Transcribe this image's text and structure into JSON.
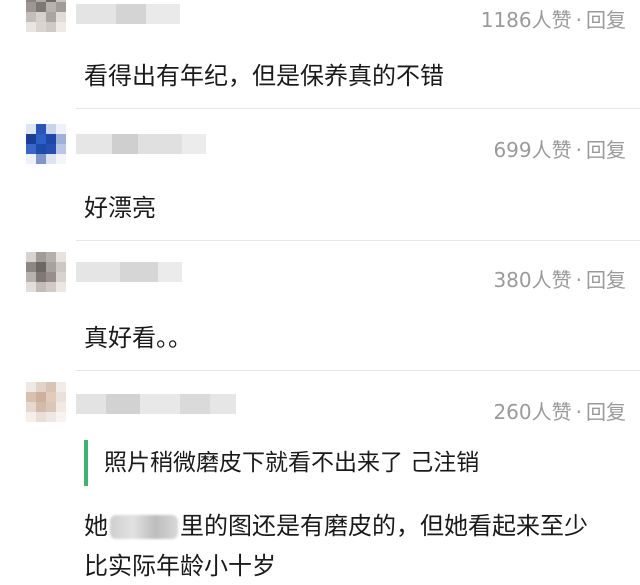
{
  "comments": [
    {
      "likes_text": "1186人赞",
      "dot": "·",
      "reply": "回复",
      "text": "看得出有年纪，但是保养真的不错"
    },
    {
      "likes_text": "699人赞",
      "dot": "·",
      "reply": "回复",
      "text": "好漂亮"
    },
    {
      "likes_text": "380人赞",
      "dot": "·",
      "reply": "回复",
      "text": "真好看。。"
    },
    {
      "likes_text": "260人赞",
      "dot": "·",
      "reply": "回复",
      "quote": "照片稍微磨皮下就看不出来了 己注销",
      "text_line1_a": "她",
      "text_line1_b": "里的图还是有磨皮的，但她看起来至少",
      "text_line2": "比实际年龄小十岁"
    }
  ]
}
